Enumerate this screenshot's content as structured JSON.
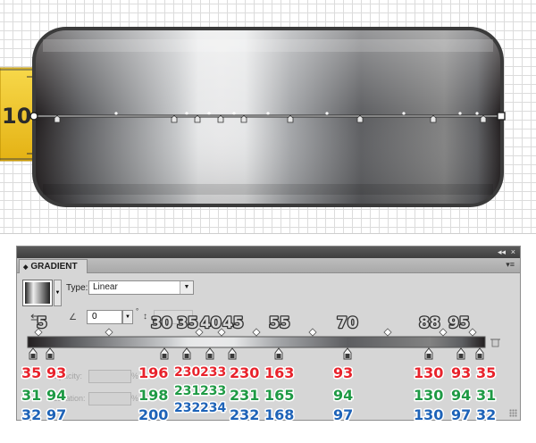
{
  "canvas": {
    "ruler_label": "10"
  },
  "panel": {
    "tab_title": "GRADIENT",
    "collapse_glyph": "◂◂",
    "close_glyph": "×",
    "menu_glyph": "▾≡",
    "type_label": "Type:",
    "type_value": "Linear",
    "angle_value": "0",
    "degree_symbol": "°",
    "opacity_label": "Opacity:",
    "location_label": "Location:",
    "percent": "%"
  },
  "gradient_stops": [
    {
      "location": "5",
      "r": "35",
      "g": "31",
      "b": "32"
    },
    {
      "location": "",
      "r": "93",
      "g": "94",
      "b": "97"
    },
    {
      "location": "30",
      "r": "196",
      "g": "198",
      "b": "200"
    },
    {
      "location": "35",
      "r": "230",
      "g": "231",
      "b": "232"
    },
    {
      "location": "40",
      "r": "233",
      "g": "233",
      "b": "234"
    },
    {
      "location": "45",
      "r": "230",
      "g": "231",
      "b": "232"
    },
    {
      "location": "55",
      "r": "163",
      "g": "165",
      "b": "168"
    },
    {
      "location": "70",
      "r": "93",
      "g": "94",
      "b": "97"
    },
    {
      "location": "88",
      "r": "130",
      "g": "130",
      "b": "130"
    },
    {
      "location": "95",
      "r": "93",
      "g": "94",
      "b": "97"
    },
    {
      "location": "",
      "r": "35",
      "g": "31",
      "b": "32"
    }
  ],
  "colors": {
    "red_annotation": "#e8232c",
    "green_annotation": "#1f9a45",
    "blue_annotation": "#1e63b8",
    "ruler_yellow": "#f2c31b"
  }
}
